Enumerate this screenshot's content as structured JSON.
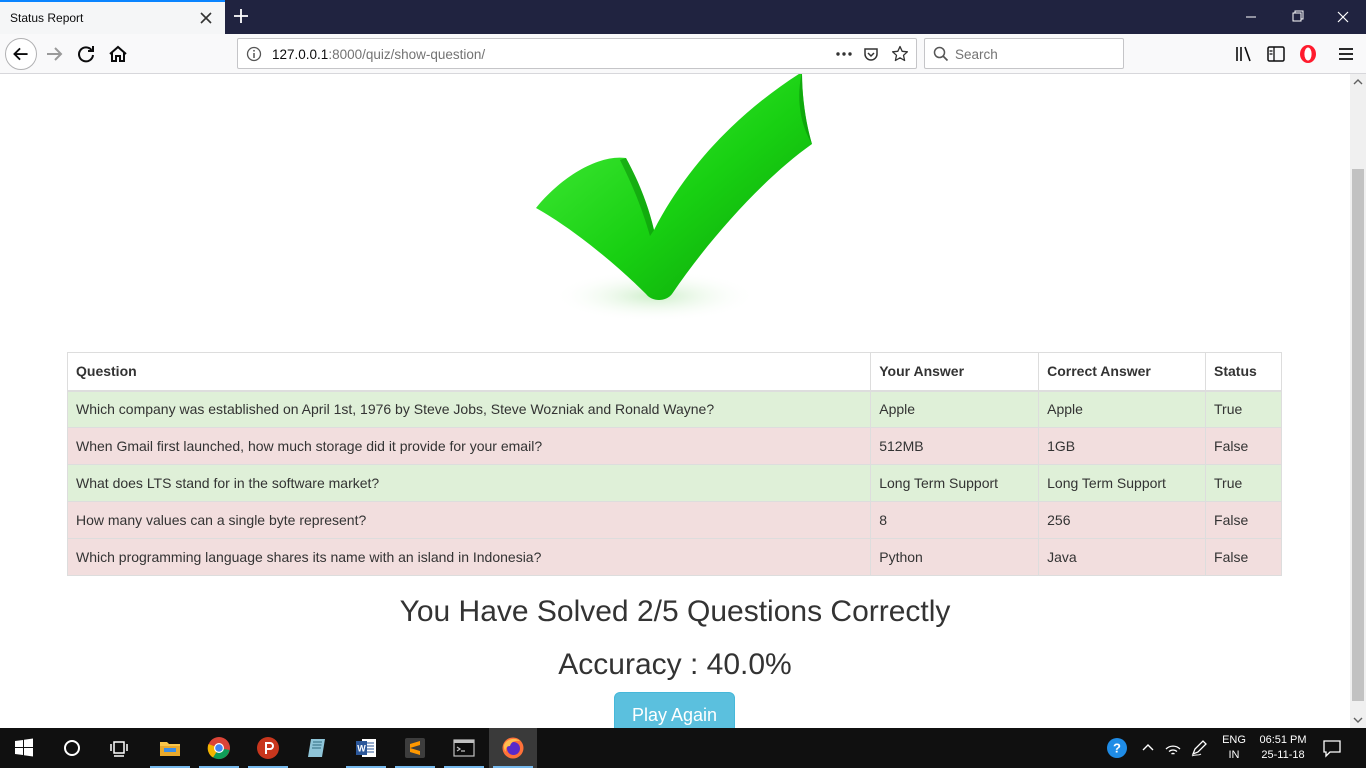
{
  "browser": {
    "tab_title": "Status Report",
    "url_host": "127.0.0.1",
    "url_rest": ":8000/quiz/show-question/",
    "search_placeholder": "Search"
  },
  "page": {
    "table_headers": [
      "Question",
      "Your Answer",
      "Correct Answer",
      "Status"
    ],
    "rows": [
      {
        "question": "Which company was established on April 1st, 1976 by Steve Jobs, Steve Wozniak and Ronald Wayne?",
        "your_answer": "Apple",
        "correct_answer": "Apple",
        "status": "True"
      },
      {
        "question": "When Gmail first launched, how much storage did it provide for your email?",
        "your_answer": "512MB",
        "correct_answer": "1GB",
        "status": "False"
      },
      {
        "question": "What does LTS stand for in the software market?",
        "your_answer": "Long Term Support",
        "correct_answer": "Long Term Support",
        "status": "True"
      },
      {
        "question": "How many values can a single byte represent?",
        "your_answer": "8",
        "correct_answer": "256",
        "status": "False"
      },
      {
        "question": "Which programming language shares its name with an island in Indonesia?",
        "your_answer": "Python",
        "correct_answer": "Java",
        "status": "False"
      }
    ],
    "score_text": "You Have Solved 2/5 Questions Correctly",
    "accuracy_text": "Accuracy : 40.0%",
    "play_again_label": "Play Again"
  },
  "taskbar": {
    "lang_line1": "ENG",
    "lang_line2": "IN",
    "time": "06:51 PM",
    "date": "25-11-18"
  },
  "colors": {
    "correct_row": "#dff0d8",
    "wrong_row": "#f2dede",
    "button": "#5bc0de",
    "tabbar": "#202340",
    "check_green": "#22d81a"
  }
}
